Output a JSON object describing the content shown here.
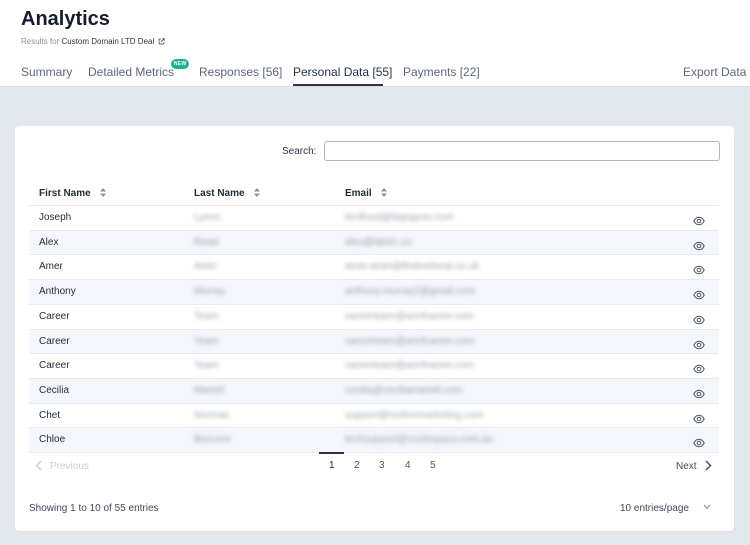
{
  "header": {
    "title": "Analytics",
    "subtitle_prefix": "Results for",
    "deal_name": "Custom Domain LTD Deal"
  },
  "tabs": {
    "summary": "Summary",
    "detailed_metrics": "Detailed Metrics",
    "new_badge": "NEW",
    "responses": "Responses [56]",
    "personal_data": "Personal Data [55]",
    "payments": "Payments [22]",
    "export": "Export Data",
    "active": "Personal Data [55]"
  },
  "search": {
    "label": "Search:",
    "value": "",
    "placeholder": ""
  },
  "table": {
    "columns": [
      "First Name",
      "Last Name",
      "Email"
    ],
    "rows": [
      {
        "first": "Joseph",
        "last": "Lyons",
        "email": "birdfood@fatpigeon.com"
      },
      {
        "first": "Alex",
        "last": "Read",
        "email": "alex@lab41.co"
      },
      {
        "first": "Amer",
        "last": "Amin",
        "email": "amer.amin@findmelocal.co.uk"
      },
      {
        "first": "Anthony",
        "last": "Murray",
        "email": "anthony.murray2@gmail.com"
      },
      {
        "first": "Career",
        "last": "Team",
        "email": "careerteam@aricfcareer.com"
      },
      {
        "first": "Career",
        "last": "Team",
        "email": "careerteam@aricfcareer.com"
      },
      {
        "first": "Career",
        "last": "Team",
        "email": "careerteam@aricfcareer.com"
      },
      {
        "first": "Cecilia",
        "last": "Martell",
        "email": "cecilia@ceciliamartell.com"
      },
      {
        "first": "Chet",
        "last": "Norman",
        "email": "support@mclinemarketing.com"
      },
      {
        "first": "Chloe",
        "last": "Beevers",
        "email": "techsupport@ccolespace.com.au"
      }
    ]
  },
  "pagination": {
    "prev": "Previous",
    "next": "Next",
    "pages": [
      "1",
      "2",
      "3",
      "4",
      "5"
    ],
    "current_page": "1"
  },
  "footer": {
    "showing": "Showing 1 to 10 of 55 entries",
    "per_page": "10 entries/page"
  },
  "icons": {
    "external_link": "external-link-icon",
    "sort": "sort-icon",
    "view": "eye-icon",
    "chevron_left": "chevron-left-icon",
    "chevron_right": "chevron-right-icon",
    "chevron_down": "chevron-down-icon"
  },
  "colors": {
    "background": "#e3e8ef",
    "badge": "#1fb39a",
    "active_tab": "#2a3547",
    "alt_row": "#f3f6fb"
  }
}
